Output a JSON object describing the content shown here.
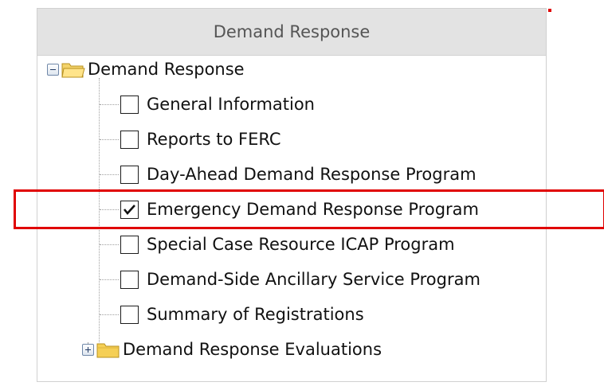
{
  "panel": {
    "title": "Demand Response"
  },
  "tree": {
    "root": {
      "label": "Demand Response",
      "expanded": true,
      "expander_icon": "minus-box-icon",
      "folder_icon": "open-folder-icon"
    },
    "items": [
      {
        "label": "General Information",
        "checked": false
      },
      {
        "label": "Reports to FERC",
        "checked": false
      },
      {
        "label": "Day-Ahead Demand Response Program",
        "checked": false
      },
      {
        "label": "Emergency Demand Response Program",
        "checked": true
      },
      {
        "label": "Special Case Resource ICAP Program",
        "checked": false
      },
      {
        "label": "Demand-Side Ancillary Service Program",
        "checked": false
      },
      {
        "label": "Summary of Registrations",
        "checked": false
      }
    ],
    "collapsed_node": {
      "label": "Demand Response Evaluations",
      "expanded": false,
      "expander_icon": "plus-box-icon",
      "folder_icon": "closed-folder-icon"
    }
  },
  "colors": {
    "highlight": "#e00000",
    "header_bg": "#e3e3e3",
    "folder": "#f2c94c"
  }
}
